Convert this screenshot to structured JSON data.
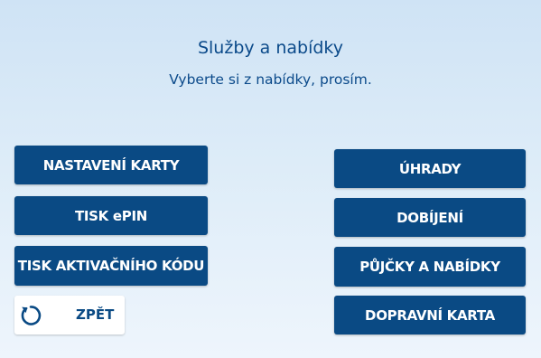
{
  "header": {
    "title": "Služby a nabídky",
    "subtitle": "Vyberte si z nabídky, prosím."
  },
  "left_menu": {
    "items": [
      {
        "label": "NASTAVENÍ KARTY"
      },
      {
        "label": "TISK ePIN"
      },
      {
        "label": "TISK AKTIVAČNÍHO KÓDU"
      }
    ]
  },
  "right_menu": {
    "items": [
      {
        "label": "ÚHRADY"
      },
      {
        "label": "DOBÍJENÍ"
      },
      {
        "label": "PŮJČKY A NABÍDKY"
      },
      {
        "label": "DOPRAVNÍ KARTA"
      }
    ]
  },
  "back": {
    "label": "ZPĚT",
    "icon": "refresh-back-icon"
  },
  "colors": {
    "primary": "#0a4a84",
    "text_heading": "#0b4a8a",
    "button_text": "#ffffff",
    "back_button_bg": "#ffffff"
  }
}
